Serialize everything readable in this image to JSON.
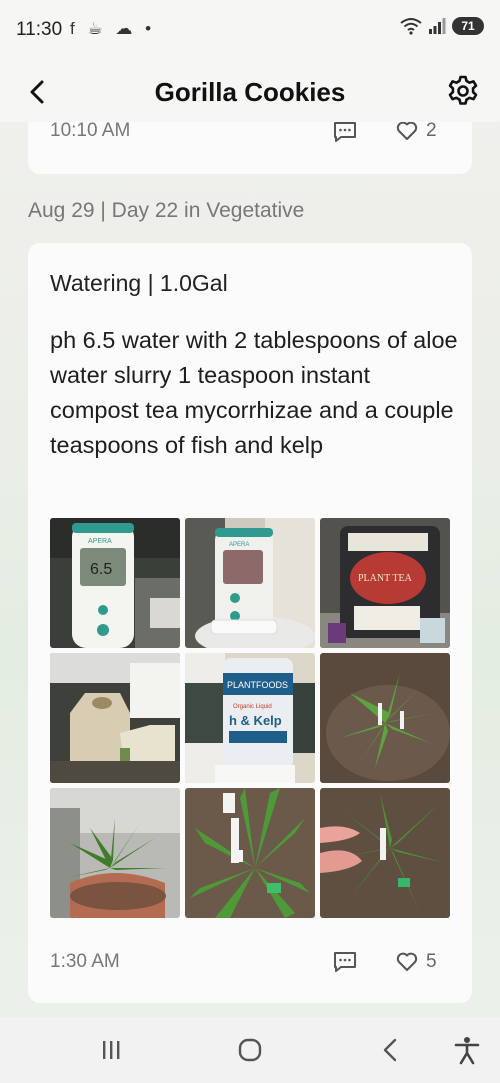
{
  "status_bar": {
    "time": "11:30",
    "notification_icons": "f ☕ ☁ •",
    "wifi_label": "5",
    "battery": "71"
  },
  "header": {
    "title": "Gorilla Cookies"
  },
  "previous_entry": {
    "time": "10:10 AM",
    "likes": "2"
  },
  "day_header": "Aug 29 | Day 22 in Vegetative",
  "entry": {
    "type": "Watering | 1.0Gal",
    "note": "ph 6.5 water with 2 tablespoons of aloe water slurry 1 teaspoon instant compost tea mycorrhizae and a couple teaspoons of fish and kelp",
    "time": "1:30 AM",
    "likes": "5",
    "photos": [
      {
        "name": "ph-meter-reading-photo",
        "meter_text": "APERA",
        "reading": "6.5"
      },
      {
        "name": "ph-meter-jug-photo",
        "meter_text": "APERA"
      },
      {
        "name": "compost-tea-bag-photo",
        "label_text": "PLANT TEA"
      },
      {
        "name": "water-jugs-photo"
      },
      {
        "name": "fish-kelp-bottle-photo",
        "label_text": "PLANTFOODS",
        "label_text_2": "Organic Liquid",
        "label_text_3": "h & Kelp"
      },
      {
        "name": "plant-topdown-photo"
      },
      {
        "name": "plant-in-tent-photo"
      },
      {
        "name": "plant-tags-photo"
      },
      {
        "name": "plant-leaf-hand-photo"
      }
    ]
  },
  "colors": {
    "accent_text": "#1c1c1c",
    "muted_text": "#777777",
    "card_bg": "#fbfbfb"
  }
}
